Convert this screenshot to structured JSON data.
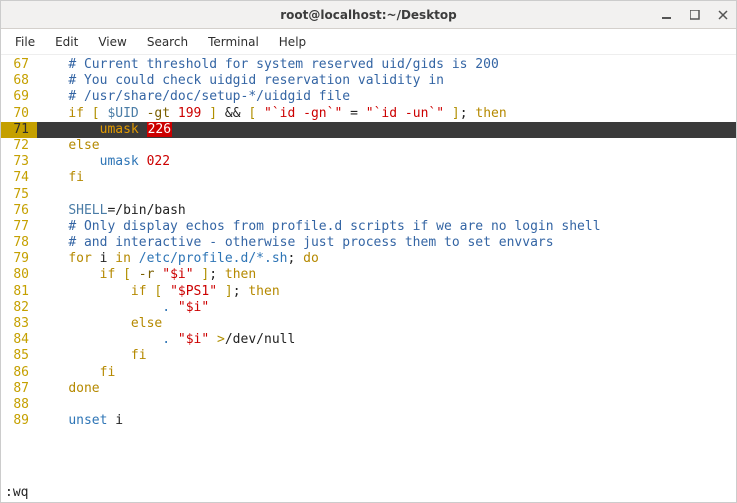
{
  "window": {
    "title": "root@localhost:~/Desktop"
  },
  "menu": {
    "file": "File",
    "edit": "Edit",
    "view": "View",
    "search": "Search",
    "terminal": "Terminal",
    "help": "Help"
  },
  "lines": {
    "l67": {
      "n": "67",
      "comment": "# Current threshold for system reserved uid/gids is 200"
    },
    "l68": {
      "n": "68",
      "comment": "# You could check uidgid reservation validity in"
    },
    "l69": {
      "n": "69",
      "comment": "# /usr/share/doc/setup-*/uidgid file"
    },
    "l70": {
      "n": "70",
      "if": "if",
      "b1": "[ ",
      "var": "$UID",
      "op": " -gt ",
      "num": "199",
      "b2": " ]",
      "and": " && ",
      "b3": "[ ",
      "s1": "\"`id -gn`\"",
      "eq": " = ",
      "s2": "\"`id -un`\"",
      "b4": " ]",
      "sc": "; ",
      "then": "then"
    },
    "l71": {
      "n": "71",
      "umask": "umask",
      "sp": " ",
      "num": "226"
    },
    "l72": {
      "n": "72",
      "else": "else"
    },
    "l73": {
      "n": "73",
      "umask": "umask",
      "num": " 022"
    },
    "l74": {
      "n": "74",
      "fi": "fi"
    },
    "l75": {
      "n": "75"
    },
    "l76": {
      "n": "76",
      "var": "SHELL",
      "eq": "=",
      "val": "/bin/bash"
    },
    "l77": {
      "n": "77",
      "comment": "# Only display echos from profile.d scripts if we are no login shell"
    },
    "l78": {
      "n": "78",
      "comment": "# and interactive - otherwise just process them to set envvars"
    },
    "l79": {
      "n": "79",
      "for": "for",
      "i": " i ",
      "in": "in",
      "path": " /etc/profile.d/*.sh",
      "sc": "; ",
      "do": "do"
    },
    "l80": {
      "n": "80",
      "if": "if",
      "b1": " [ ",
      "op": "-r ",
      "s": "\"$i\"",
      "b2": " ]",
      "sc": "; ",
      "then": "then"
    },
    "l81": {
      "n": "81",
      "if": "if",
      "b1": " [ ",
      "s": "\"$PS1\"",
      "b2": " ]",
      "sc": "; ",
      "then": "then"
    },
    "l82": {
      "n": "82",
      "dot": ". ",
      "s": "\"$i\""
    },
    "l83": {
      "n": "83",
      "else": "else"
    },
    "l84": {
      "n": "84",
      "dot": ". ",
      "s": "\"$i\"",
      "redir": " >",
      "path": "/dev/null"
    },
    "l85": {
      "n": "85",
      "fi": "fi"
    },
    "l86": {
      "n": "86",
      "fi": "fi"
    },
    "l87": {
      "n": "87",
      "done": "done"
    },
    "l88": {
      "n": "88"
    },
    "l89": {
      "n": "89",
      "unset": "unset",
      "i": " i"
    }
  },
  "status": ":wq"
}
